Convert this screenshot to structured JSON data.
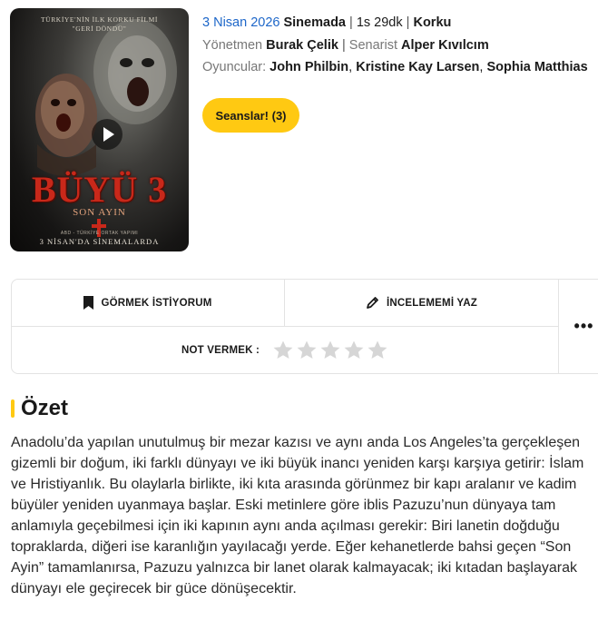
{
  "poster": {
    "tagline_1": "TÜRKİYE'NİN İLK KORKU FİLMİ",
    "tagline_2": "\"GERİ DÖNDÜ\"",
    "title": "BÜYÜ 3",
    "subtitle": "SON AYIN",
    "small_text": "ABD - TÜRKİYE ORTAK YAPIMI",
    "release_note": "3 NİSAN'DA SİNEMALARDA",
    "play_icon": "play-icon"
  },
  "movie": {
    "release_date": "3 Nisan 2026",
    "status": "Sinemada",
    "separator": "|",
    "duration": "1s 29dk",
    "genre": "Korku",
    "director_label": "Yönetmen",
    "director": "Burak Çelik",
    "writer_label": "Senarist",
    "writer": "Alper Kıvılcım",
    "cast_label": "Oyuncular:",
    "cast": [
      "John Philbin",
      "Kristine Kay Larsen",
      "Sophia Matthias"
    ]
  },
  "sessions_button": "Seanslar! (3)",
  "actions": {
    "want_to_watch": "GÖRMEK İSTİYORUM",
    "write_review": "İNCELEMEMİ YAZ",
    "rate_label": "NOT VERMEK :",
    "rating_value": 0,
    "rating_max": 5,
    "more": "•••"
  },
  "summary": {
    "title": "Özet",
    "text": "Anadolu’da yapılan unutulmuş bir mezar kazısı ve aynı anda Los Angeles’ta gerçekleşen gizemli bir doğum, iki farklı dünyayı ve iki büyük inancı yeniden karşı karşıya getirir: İslam ve Hristiyanlık. Bu olaylarla birlikte, iki kıta arasında görünmez bir kapı aralanır ve kadim büyüler yeniden uyanmaya başlar. Eski metinlere göre iblis Pazuzu’nun dünyaya tam anlamıyla geçebilmesi için iki kapının aynı anda açılması gerekir: Biri lanetin doğduğu topraklarda, diğeri ise karanlığın yayılacağı yerde. Eğer kehanetlerde bahsi geçen “Son Ayin” tamamlanırsa, Pazuzu yalnızca bir lanet olarak kalmayacak; iki kıtadan başlayarak dünyayı ele geçirecek bir güce dönüşecektir."
  },
  "colors": {
    "accent_yellow": "#ffc912",
    "date_blue": "#1e67c9",
    "border": "#e3e3e3",
    "star_empty": "#d6d6d6"
  }
}
